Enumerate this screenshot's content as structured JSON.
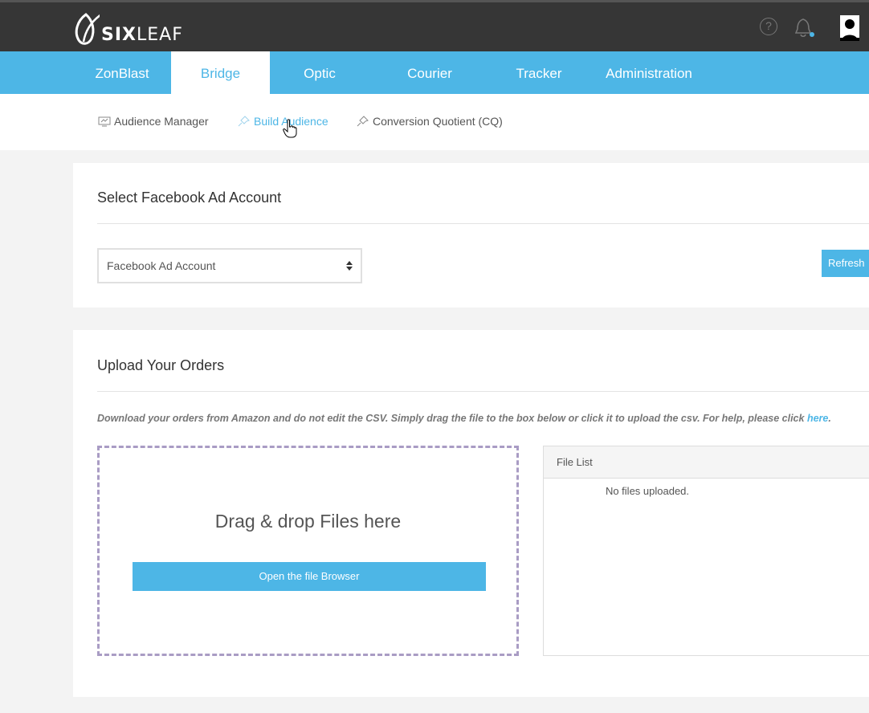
{
  "brand": {
    "bold": "SIX",
    "light": "LEAF"
  },
  "header": {
    "help_glyph": "?",
    "icons": [
      "help-icon",
      "bell-icon",
      "avatar"
    ]
  },
  "nav": {
    "items": [
      {
        "label": "ZonBlast",
        "active": false
      },
      {
        "label": "Bridge",
        "active": true
      },
      {
        "label": "Optic",
        "active": false
      },
      {
        "label": "Courier",
        "active": false
      },
      {
        "label": "Tracker",
        "active": false
      },
      {
        "label": "Administration",
        "active": false
      }
    ]
  },
  "subnav": {
    "items": [
      {
        "label": "Audience Manager",
        "icon": "monitor-icon",
        "active": false
      },
      {
        "label": "Build Audience",
        "icon": "pin-icon",
        "active": true
      },
      {
        "label": "Conversion Quotient (CQ)",
        "icon": "pin-icon",
        "active": false
      }
    ]
  },
  "ad_account": {
    "title": "Select Facebook Ad Account",
    "select_value": "Facebook Ad Account",
    "refresh_label": "Refresh"
  },
  "upload": {
    "title": "Upload Your Orders",
    "instructions": "Download your orders from Amazon and do not edit the CSV. Simply drag the file to the box below or click it to upload the csv. For help, please click ",
    "help_link": "here",
    "instructions_end": ".",
    "drop_text": "Drag & drop Files here",
    "browse_label": "Open the file Browser",
    "file_list_title": "File List",
    "file_list_empty": "No files uploaded."
  },
  "colors": {
    "accent": "#4db6e6",
    "topbar": "#363636",
    "dropzone_border": "#a99cc4"
  }
}
